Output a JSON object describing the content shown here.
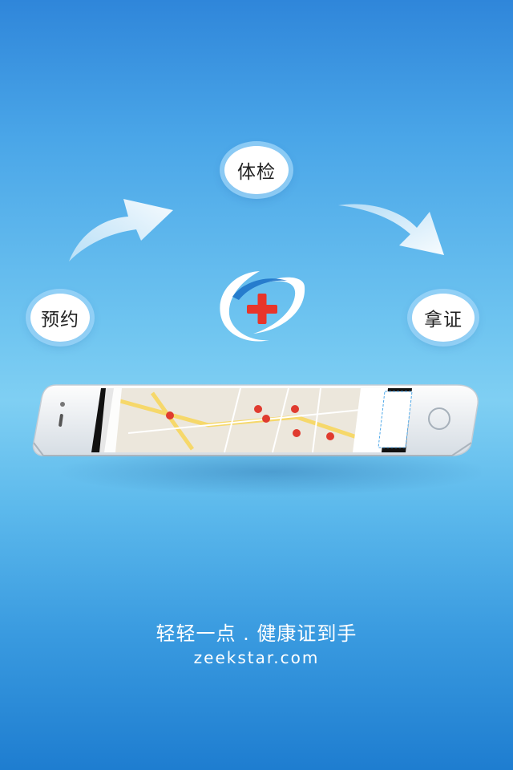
{
  "steps": [
    {
      "label": "预约"
    },
    {
      "label": "体检"
    },
    {
      "label": "拿证"
    }
  ],
  "footer": {
    "slogan": "轻轻一点 . 健康证到手",
    "url": "zeekstar.com"
  },
  "colors": {
    "background_top": "#2f86da",
    "background_mid": "#7fcff3",
    "background_bottom": "#1e7dd0",
    "logo_red": "#e8352a",
    "logo_blue": "#1f74c9",
    "bubble_ring": "#a0d7fa"
  },
  "icons": [
    "arrow-right-up-icon",
    "arrow-right-down-icon",
    "medical-logo-icon",
    "map-pin-icon",
    "home-button-icon"
  ]
}
